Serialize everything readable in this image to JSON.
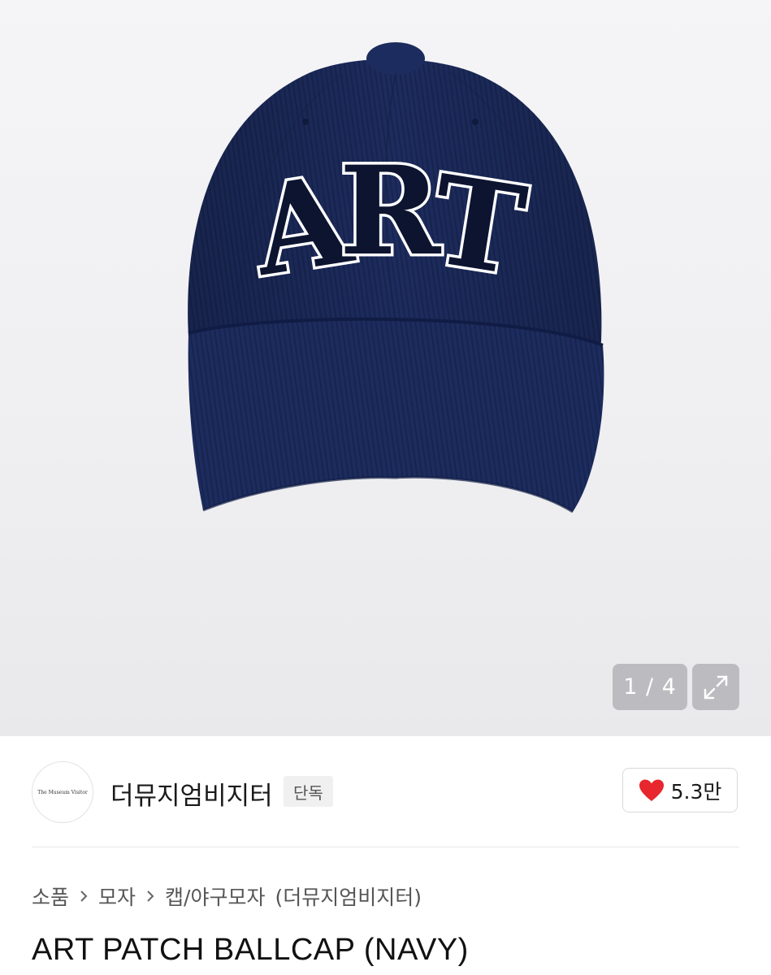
{
  "gallery": {
    "counter": "1 / 4",
    "hat_patch_text": "ART"
  },
  "brand": {
    "logo_text": "The Museum Visitor",
    "name": "더뮤지엄비지터",
    "badge": "단독"
  },
  "like": {
    "count": "5.3만"
  },
  "breadcrumb": {
    "items": [
      "소품",
      "모자",
      "캡/야구모자"
    ],
    "brand_suffix": "(더뮤지엄비지터)"
  },
  "product": {
    "title": "ART PATCH BALLCAP (NAVY)"
  },
  "colors": {
    "cap_navy": "#1b2b5c",
    "heart_red": "#e8262d",
    "gallery_bg": "#f2f2f4"
  }
}
